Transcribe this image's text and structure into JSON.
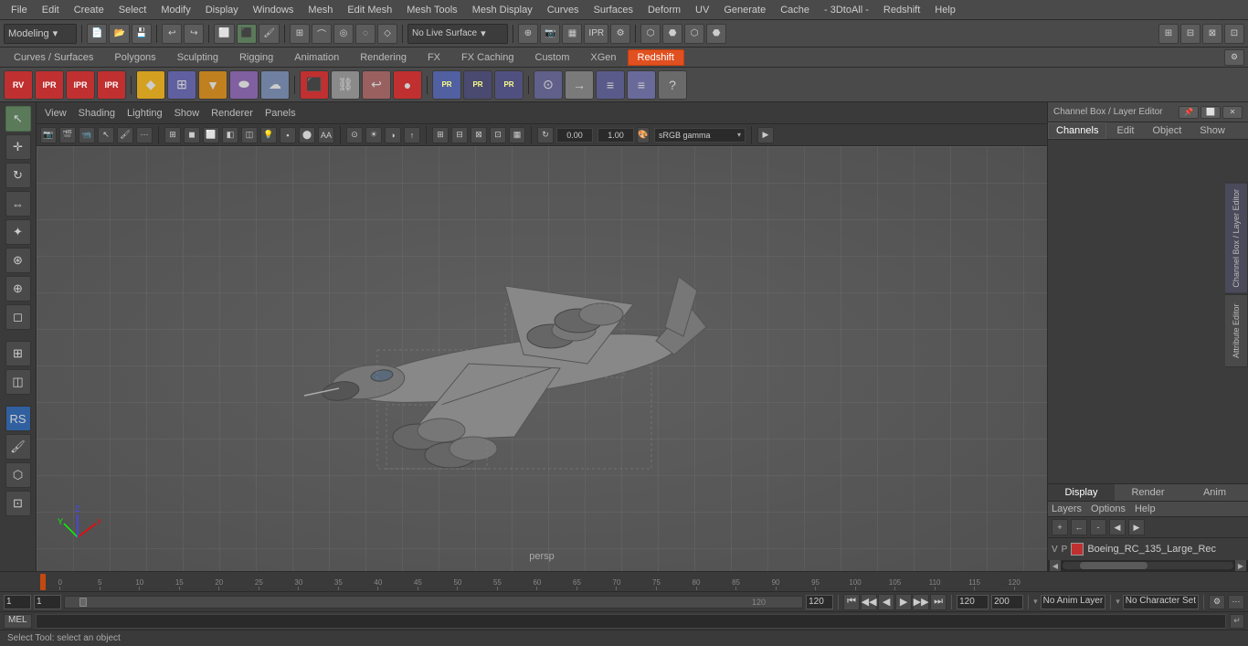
{
  "menu": {
    "items": [
      "File",
      "Edit",
      "Create",
      "Select",
      "Modify",
      "Display",
      "Windows",
      "Mesh",
      "Edit Mesh",
      "Mesh Tools",
      "Mesh Display",
      "Curves",
      "Surfaces",
      "Deform",
      "UV",
      "Generate",
      "Cache",
      "- 3DtoAll -",
      "Redshift",
      "Help"
    ]
  },
  "toolbar1": {
    "mode_label": "Modeling",
    "no_live_surface": "No Live Surface"
  },
  "shelf_tabs": {
    "items": [
      "Curves / Surfaces",
      "Polygons",
      "Sculpting",
      "Rigging",
      "Animation",
      "Rendering",
      "FX",
      "FX Caching",
      "Custom",
      "XGen",
      "Redshift"
    ],
    "active": "Redshift"
  },
  "viewport": {
    "menu": {
      "view": "View",
      "shading": "Shading",
      "lighting": "Lighting",
      "show": "Show",
      "renderer": "Renderer",
      "panels": "Panels"
    },
    "camera_value": "0.00",
    "focal_value": "1.00",
    "color_space": "sRGB gamma",
    "label": "persp"
  },
  "right_panel": {
    "title": "Channel Box / Layer Editor",
    "tabs": {
      "channels": "Channels",
      "edit": "Edit",
      "object": "Object",
      "show": "Show"
    },
    "vertical_tabs": {
      "channel_box": "Channel Box / Layer Editor",
      "attribute_editor": "Attribute Editor"
    }
  },
  "layer_editor": {
    "display_tabs": [
      "Display",
      "Render",
      "Anim"
    ],
    "active_display_tab": "Display",
    "menu_items": [
      "Layers",
      "Options",
      "Help"
    ],
    "layer_row": {
      "v": "V",
      "p": "P",
      "name": "Boeing_RC_135_Large_Rec"
    }
  },
  "timeline": {
    "ticks": [
      0,
      5,
      10,
      15,
      20,
      25,
      30,
      35,
      40,
      45,
      50,
      55,
      60,
      65,
      70,
      75,
      80,
      85,
      90,
      95,
      100,
      105,
      110,
      115,
      120
    ],
    "playhead": 1
  },
  "bottom_controls": {
    "frame_current": "1",
    "frame_start": "1",
    "frame_slider_start": "1",
    "frame_slider_end": "120",
    "frame_end": "120",
    "anim_end": "200",
    "no_anim_layer": "No Anim Layer",
    "no_character_set": "No Character Set"
  },
  "script_bar": {
    "lang": "MEL",
    "placeholder": ""
  },
  "status_bar": {
    "text": "Select Tool: select an object"
  },
  "playback": {
    "buttons": [
      "⏮",
      "◀◀",
      "◀",
      "▶",
      "▶▶",
      "⏭"
    ]
  }
}
